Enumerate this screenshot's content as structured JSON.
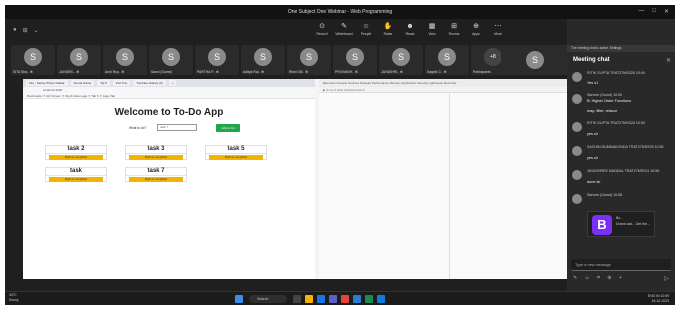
{
  "window": {
    "title": "One Subject One Webinar - Web Programming",
    "controls": [
      "—",
      "□",
      "✕"
    ]
  },
  "toolbar": {
    "left_icons": [
      "●",
      "⊞",
      "⌄"
    ],
    "buttons": [
      {
        "label": "Record",
        "icon": "rec-icon"
      },
      {
        "label": "Whiteboard",
        "icon": "whiteboard-icon"
      },
      {
        "label": "People",
        "icon": "people-icon"
      },
      {
        "label": "Raise",
        "icon": "raise-icon"
      },
      {
        "label": "React",
        "icon": "react-icon"
      },
      {
        "label": "View",
        "icon": "view-icon"
      },
      {
        "label": "Rooms",
        "icon": "rooms-icon"
      },
      {
        "label": "Apps",
        "icon": "apps-icon"
      },
      {
        "label": "More",
        "icon": "more-icon"
      },
      {
        "label": "Camera",
        "icon": "camera-icon"
      },
      {
        "label": "Mic",
        "icon": "mic-icon"
      },
      {
        "label": "Share",
        "icon": "share-icon"
      }
    ],
    "leave_label": "Leave"
  },
  "participants": [
    {
      "initial": "S",
      "name": "SITA Sha.. ✻"
    },
    {
      "initial": "S",
      "name": "JAYASRI... ✻"
    },
    {
      "initial": "S",
      "name": "Anni Roy.. ✻"
    },
    {
      "initial": "S",
      "name": "Sanvi (Guest)"
    },
    {
      "initial": "S",
      "name": "PARTHA P.. ✻"
    },
    {
      "initial": "S",
      "name": "Aditya Rai.. ✻"
    },
    {
      "initial": "S",
      "name": "Rishi Gill.. ✻"
    },
    {
      "initial": "S",
      "name": "PRIYANSH.. ✻"
    },
    {
      "initial": "S",
      "name": "JAYASHRI.. ✻"
    },
    {
      "initial": "S",
      "name": "Sagnik C.. ✻"
    },
    {
      "initial": "S",
      "name": "Pratik Gh.. ✻"
    },
    {
      "initial": "+8",
      "name": "Participants"
    }
  ],
  "browser": {
    "tabs": [
      "Fire - Sense Phono Ndelar",
      "Sound Game",
      "Tip 5",
      "Port Fun",
      "Tumblee Gianza (5)",
      "+"
    ],
    "address": "localhost:3000",
    "bookmarks": "Bookmarks   ✦ GD Screen   ✦ Dig & Data Lage   ✦ Tab 5   ✦ Apps Tab"
  },
  "app": {
    "title": "Welcome to To-Do App",
    "input_label": "What to do?",
    "input_value": "task 7",
    "add_label": "Add to list",
    "tasks": [
      {
        "name": "task 2",
        "btn": "Mark as completed"
      },
      {
        "name": "task 3",
        "btn": "Mark as completed"
      },
      {
        "name": "task 5",
        "btn": "Mark as completed"
      },
      {
        "name": "task",
        "btn": "Mark as completed"
      },
      {
        "name": "task 7",
        "btn": "Mark as completed"
      }
    ]
  },
  "devtools": {
    "tabs": "Elements   Console   Sources   Network   Performance   Memory   Application   Security   Lighthouse   Recorder",
    "subbar": "▶  ⊘  top  ▾   Filter                                          Default levels ▾"
  },
  "chat": {
    "note": "The meeting chat is active. Settings",
    "title": "Meeting chat",
    "messages": [
      {
        "name": "RITIK GUPTA   TRAT27MSS28   10:49",
        "text": "Yes s1"
      },
      {
        "name": "Sanvee (Guest)   10:50",
        "text": "B: Higher Order Functions"
      },
      {
        "name": "",
        "text": "map, filter, reduce"
      },
      {
        "name": "RITIK GUPTA   TRAT27MSS28   10:53",
        "text": "yes sir"
      },
      {
        "name": "SACHIN DUMMAKONDA   TRAT27MSS09   10:55",
        "text": "yes sir"
      },
      {
        "name": "JAYASHREE MANDAL   TRAT27MSS11   10:56",
        "text": "done sir"
      },
      {
        "name": "Sanvee (Guest)   10:58",
        "text": "https://getbootstrap.com/docs/5.3/getting-started/"
      }
    ],
    "link_preview": {
      "title": "Bo...",
      "text": "Downl oad... Get the..."
    },
    "compose_placeholder": "Type a new message",
    "compose_icons": "✎ ☺ ⌗ ⊕ +",
    "send_icon": "▷"
  },
  "taskbar": {
    "weather": "34°C",
    "weather_sub": "Sunny",
    "search": "Search",
    "time": "10:59",
    "date": "16-10-2023",
    "tray": "ENG  IN"
  }
}
